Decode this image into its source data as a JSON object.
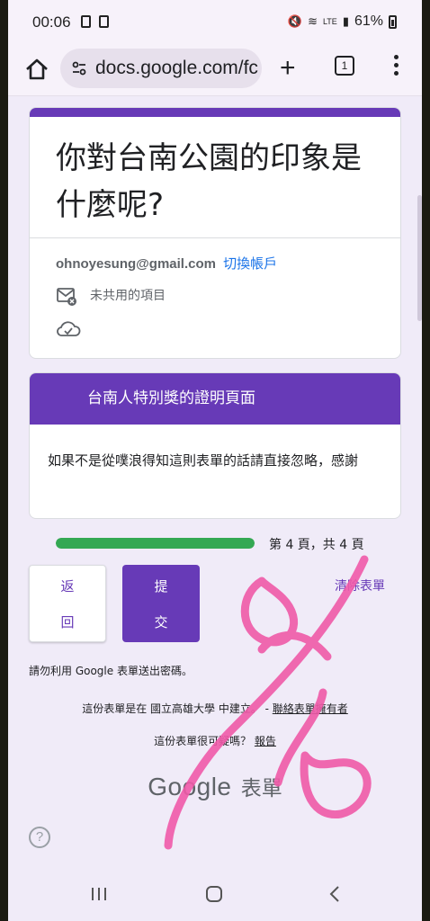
{
  "status_bar": {
    "time": "00:06",
    "network": "LTE",
    "battery": "61%"
  },
  "browser": {
    "url": "docs.google.com/fc",
    "tab_count": "1"
  },
  "form": {
    "title": "你對台南公園的印象是什麼呢?",
    "account_email": "ohnoyesung@gmail.com",
    "switch_account": "切換帳戶",
    "not_shared": "未共用的項目",
    "section_title": "台南人特別獎的證明頁面",
    "section_description": "如果不是從噗浪得知這則表單的話請直接忽略，感謝",
    "progress": {
      "fraction": 1.0,
      "label": "第 4 頁，共 4 頁"
    },
    "back_button": [
      "返",
      "回"
    ],
    "submit_button": [
      "提",
      "交"
    ],
    "clear_form": "清除表單",
    "password_warning": "請勿利用 Google 表單送出密碼。",
    "footer_created": "這份表單是在 國立高雄大學 中建立。 - ",
    "footer_contact": "聯絡表單擁有者",
    "footer_suspicious": "這份表單很可疑嗎？",
    "footer_report": "報告",
    "brand_google": "Google",
    "brand_forms": "表單",
    "help": "?"
  },
  "colors": {
    "accent": "#673ab7",
    "progress": "#34a853",
    "link": "#1a73e8",
    "background": "#f0ebf8",
    "ink_overlay": "#ef5aa8"
  }
}
